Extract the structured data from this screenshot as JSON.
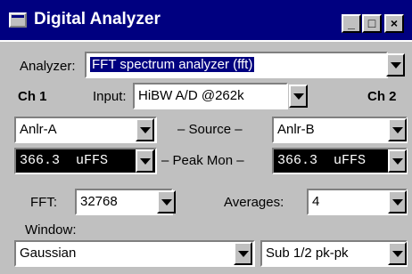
{
  "window": {
    "title": "Digital Analyzer",
    "controls": {
      "minimize": "_",
      "maximize": "□",
      "close": "×"
    }
  },
  "analyzer": {
    "label": "Analyzer:",
    "value": "FFT spectrum analyzer (fft)"
  },
  "channels": {
    "ch1_label": "Ch 1",
    "ch2_label": "Ch 2",
    "input_label": "Input:",
    "input_value": "HiBW A/D @262k"
  },
  "source": {
    "label": "– Source –",
    "ch1_value": "Anlr-A",
    "ch2_value": "Anlr-B"
  },
  "peak_mon": {
    "label": "– Peak Mon –",
    "ch1_value": "366.3  uFFS",
    "ch2_value": "366.3  uFFS"
  },
  "fft": {
    "label": "FFT:",
    "value": "32768"
  },
  "averages": {
    "label": "Averages:",
    "value": "4"
  },
  "window_func": {
    "label": "Window:",
    "value": "Gaussian",
    "mode_value": "Sub 1/2 pk-pk"
  },
  "icons": [
    "window-icon",
    "dropdown-arrow-icon"
  ]
}
